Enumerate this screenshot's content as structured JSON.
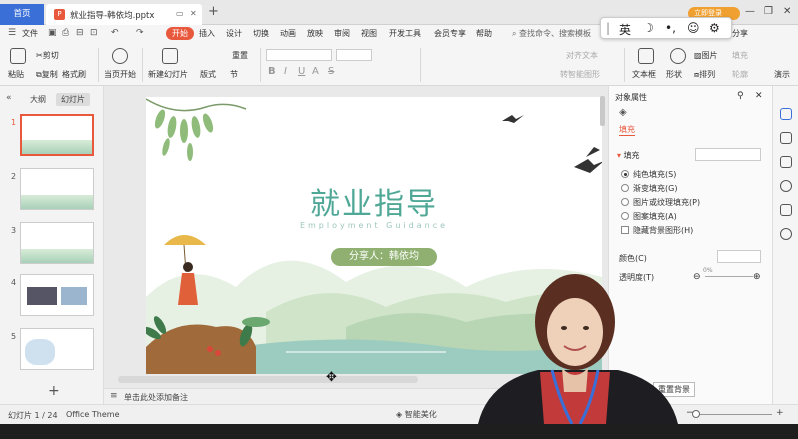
{
  "titlebar": {
    "home_tab": "首页",
    "doc_tab": "就业指导-韩依均.pptx",
    "doc_icon": "P",
    "new_tab": "+",
    "login_label": "立即登录"
  },
  "menu": {
    "file": "文件",
    "items": [
      "开始",
      "插入",
      "设计",
      "切换",
      "动画",
      "放映",
      "审阅",
      "视图",
      "开发工具",
      "会员专享",
      "帮助"
    ],
    "active_index": 0,
    "search_placeholder": "查找命令、搜索模板",
    "share": "分享"
  },
  "ime": {
    "lang": "英"
  },
  "ribbon": {
    "paste": "粘贴",
    "cut": "剪切",
    "copy": "复制",
    "format_painter": "格式刷",
    "play_from_current": "当页开始",
    "new_slide": "新建幻灯片",
    "layout": "版式",
    "section": "节",
    "reset": "重置",
    "align_text": "对齐文本",
    "convert_smartart": "转智能图形",
    "textbox": "文本框",
    "shape": "形状",
    "picture": "图片",
    "arrange": "排列",
    "fill": "填充",
    "outline": "轮廓",
    "show": "演示"
  },
  "left_panel": {
    "tab_outline": "大纲",
    "tab_slides": "幻灯片",
    "slides": [
      1,
      2,
      3,
      4,
      5
    ],
    "add": "+"
  },
  "slide": {
    "title": "就业指导",
    "subtitle": "Employment Guidance",
    "presenter": "分享人：韩依均"
  },
  "notes": {
    "placeholder": "单击此处添加备注"
  },
  "status": {
    "slide_counter": "幻灯片 1 / 24",
    "theme": "Office Theme",
    "beautify": "智能美化"
  },
  "right_panel": {
    "title": "对象属性",
    "tab_fill": "填充",
    "section_fill": "填充",
    "options": [
      "纯色填充(S)",
      "渐变填充(G)",
      "图片或纹理填充(P)",
      "图案填充(A)"
    ],
    "selected_option": 0,
    "hide_bg": "隐藏背景图形(H)",
    "color_label": "颜色(C)",
    "transparency_label": "透明度(T)",
    "transparency_value": "0%",
    "apply_bg": "重置背景"
  },
  "colors": {
    "accent": "#e8583d",
    "home_tab": "#3a6fd8",
    "title_green": "#4fa896",
    "presenter_bg": "#8fb070"
  }
}
